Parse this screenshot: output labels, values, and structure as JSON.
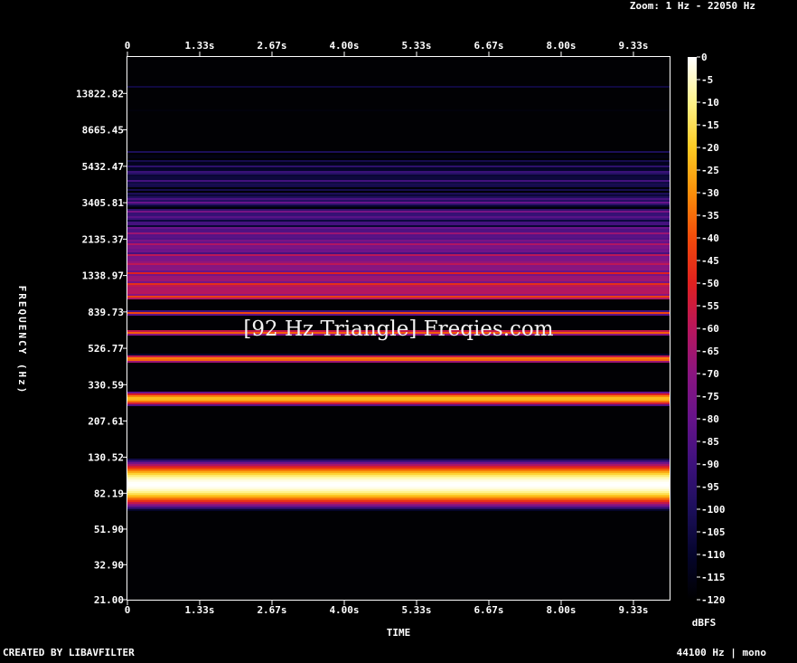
{
  "header": {
    "zoom": "Zoom: 1 Hz - 22050 Hz"
  },
  "footer": {
    "created_by": "CREATED BY LIBAVFILTER",
    "sample_info": "44100 Hz | mono"
  },
  "watermark": "[92 Hz Triangle] Freqies.com",
  "chart_data": {
    "type": "heatmap",
    "title": "",
    "xlabel": "TIME",
    "ylabel": "FREQUENCY (Hz)",
    "colorbar_label": "dBFS",
    "x_ticks": [
      "0",
      "1.33s",
      "2.67s",
      "4.00s",
      "5.33s",
      "6.67s",
      "8.00s",
      "9.33s"
    ],
    "y_ticks": [
      "21.00",
      "32.90",
      "51.90",
      "82.19",
      "130.52",
      "207.61",
      "330.59",
      "526.77",
      "839.73",
      "1338.97",
      "2135.37",
      "3405.81",
      "5432.47",
      "8665.45",
      "13822.82"
    ],
    "y_scale": "log",
    "xlim": [
      0,
      10
    ],
    "ylim": [
      21,
      22050
    ],
    "colorbar_ticks": [
      "0",
      "-5",
      "-10",
      "-15",
      "-20",
      "-25",
      "-30",
      "-35",
      "-40",
      "-45",
      "-50",
      "-55",
      "-60",
      "-65",
      "-70",
      "-75",
      "-80",
      "-85",
      "-90",
      "-95",
      "-100",
      "-105",
      "-110",
      "-115",
      "-120"
    ],
    "colorbar_range": [
      -120,
      0
    ],
    "fundamental_hz": 92,
    "harmonics_db": [
      {
        "hz": 92,
        "db": 0
      },
      {
        "hz": 276,
        "db": -22
      },
      {
        "hz": 460,
        "db": -31
      },
      {
        "hz": 644,
        "db": -37
      },
      {
        "hz": 828,
        "db": -41
      },
      {
        "hz": 1012,
        "db": -45
      },
      {
        "hz": 1196,
        "db": -48
      },
      {
        "hz": 1380,
        "db": -50
      },
      {
        "hz": 2000,
        "db": -62
      },
      {
        "hz": 5000,
        "db": -85
      },
      {
        "hz": 15000,
        "db": -105
      }
    ]
  },
  "colors": {
    "background": "#000000",
    "text": "#ffffff",
    "colormap": [
      "#000000",
      "#05052c",
      "#1c0f5a",
      "#3d117c",
      "#66138a",
      "#8a1580",
      "#b8165c",
      "#e0201f",
      "#f24b0b",
      "#fa8f0a",
      "#fdcb23",
      "#fff38a",
      "#ffffff"
    ]
  }
}
